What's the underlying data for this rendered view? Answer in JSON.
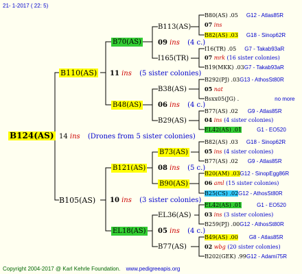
{
  "header": {
    "timestamp": "21-  1-2017  ( 22:  5)"
  },
  "root": {
    "id": "B124(AS)"
  },
  "gen1": [
    {
      "id": "B110(AS)",
      "year": "11",
      "ins": "ins",
      "note": "(5 sister colonies)"
    },
    {
      "id": "B105(AS)",
      "year": "10",
      "ins": "ins",
      "note": "(3 sister colonies)"
    }
  ],
  "root_mating": {
    "year": "14",
    "ins": "ins",
    "note": "(Drones from 5 sister colonies)"
  },
  "gen2": [
    {
      "id": "B70(AS)",
      "year": "09",
      "ins": "ins",
      "note": "(4 c.)"
    },
    {
      "id": "B48(AS)",
      "year": "06",
      "ins": "ins",
      "note": "(4 c.)"
    },
    {
      "id": "B121(AS)",
      "year": "08",
      "ins": "ins",
      "note": "(5 c.)"
    },
    {
      "id": "EL18(AS)",
      "year": "05",
      "ins": "ins",
      "note": "(4 c.)"
    }
  ],
  "gen3": [
    "B113(AS)",
    "I165(TR)",
    "B38(AS)",
    "B29(AS)",
    "B73(AS)",
    "B90(AS)",
    "EL36(AS)",
    "B77(AS)"
  ],
  "gen4": [
    {
      "a": "B80(AS) .05",
      "b": "G12 - Atlas85R"
    },
    {
      "a": "07",
      "ins": "ins",
      "c": ""
    },
    {
      "a": "B82(AS) .03",
      "b": "G18 - Sinop62R"
    },
    {
      "a": "I16(TR) .05",
      "b": "G7 - Takab93aR"
    },
    {
      "a": "07",
      "ins": "mrk",
      "c": "(16 sister colonies)"
    },
    {
      "a": "B19(MKK) .03",
      "b": "G7 - Takab93aR"
    },
    {
      "a": "B292(PJ) .03",
      "b": "G13 - AthosSt80R"
    },
    {
      "a": "05",
      "ins": "nat",
      "c": ""
    },
    {
      "a": "Bsxx05(JG) .",
      "b": "no more"
    },
    {
      "a": "B77(AS) .02",
      "b": "G9 - Atlas85R"
    },
    {
      "a": "04",
      "ins": "ins",
      "c": "(4 sister colonies)"
    },
    {
      "a": "EL42(AS) .01",
      "b": "G1 - EO520"
    },
    {
      "a": "B82(AS) .03",
      "b": "G18 - Sinop62R"
    },
    {
      "a": "05",
      "ins": "ins",
      "c": "(4 sister colonies)"
    },
    {
      "a": "B77(AS) .02",
      "b": "G9 - Atlas85R"
    },
    {
      "a": "B20(AM) .03",
      "b": "G12 - SinopEgg86R"
    },
    {
      "a": "06",
      "ins": "aml",
      "c": "(15 sister colonies)"
    },
    {
      "a": "B25(CS) .02",
      "b": "G12 - AthosSt80R"
    },
    {
      "a": "EL42(AS) .01",
      "b": "G1 - EO520"
    },
    {
      "a": "03",
      "ins": "ins",
      "c": "(3 sister colonies)"
    },
    {
      "a": "B259(PJ) .00",
      "b": "G12 - AthosSt80R"
    },
    {
      "a": "B49(AS) .00",
      "b": "G8 - Atlas85R"
    },
    {
      "a": "02",
      "ins": "wbg",
      "c": "(20 sister colonies)"
    },
    {
      "a": "B202(GEK) .99",
      "b": "G12 - Adami75R"
    }
  ],
  "footer": {
    "copyright": "Copyright 2004-2017 @ Karl Kehrle Foundation.",
    "url": "www.pedigreeapis.org"
  }
}
